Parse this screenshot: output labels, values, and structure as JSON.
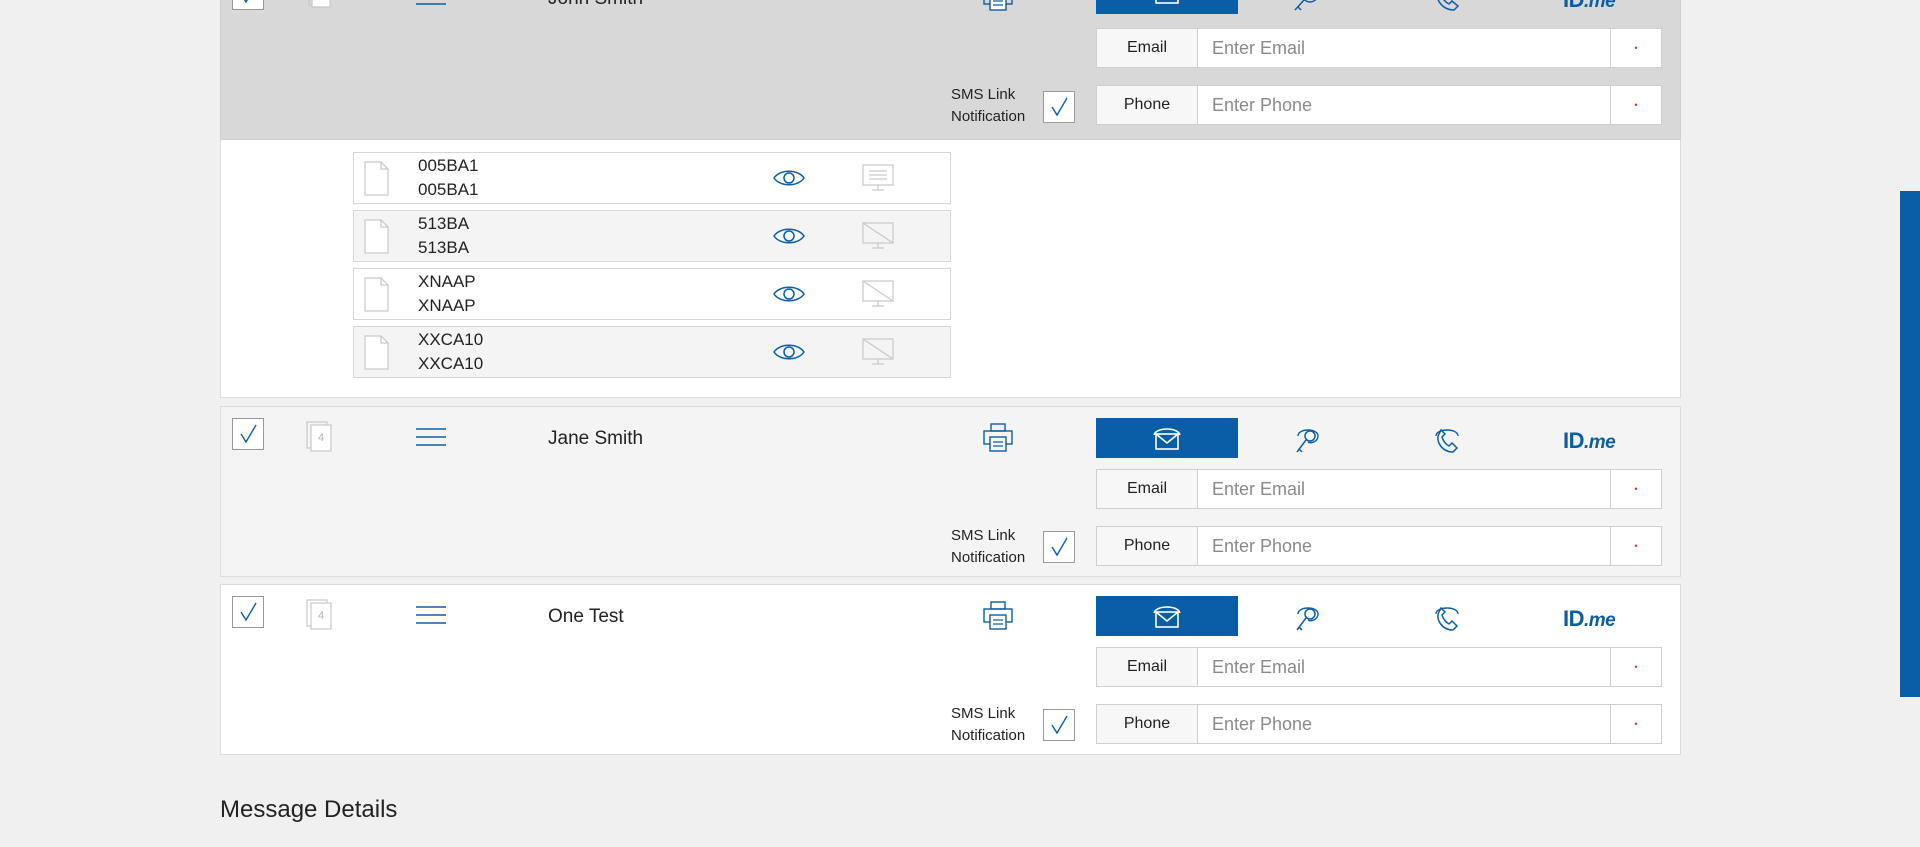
{
  "recipients": [
    {
      "name": "John Smith",
      "email_label": "Email",
      "email_placeholder": "Enter Email",
      "phone_label": "Phone",
      "phone_placeholder": "Enter Phone",
      "sms_line1": "SMS Link",
      "sms_line2": "Notification",
      "required_mark": "•"
    },
    {
      "name": "Jane Smith",
      "doc_count": "4",
      "email_label": "Email",
      "email_placeholder": "Enter Email",
      "phone_label": "Phone",
      "phone_placeholder": "Enter Phone",
      "sms_line1": "SMS Link",
      "sms_line2": "Notification",
      "required_mark": "•"
    },
    {
      "name": "One Test",
      "doc_count": "4",
      "email_label": "Email",
      "email_placeholder": "Enter Email",
      "phone_label": "Phone",
      "phone_placeholder": "Enter Phone",
      "sms_line1": "SMS Link",
      "sms_line2": "Notification",
      "required_mark": "•"
    }
  ],
  "documents": [
    {
      "code": "005BA1",
      "name": "005BA1"
    },
    {
      "code": "513BA",
      "name": "513BA"
    },
    {
      "code": "XNAAP",
      "name": "XNAAP"
    },
    {
      "code": "XXCA10",
      "name": "XXCA10"
    }
  ],
  "idme": {
    "id": "ID",
    "dot_me": ".me"
  },
  "section_title": "Message Details",
  "colors": {
    "accent": "#0a5ea8",
    "row_expanded": "#d8d8d8",
    "required": "#dd3333"
  }
}
